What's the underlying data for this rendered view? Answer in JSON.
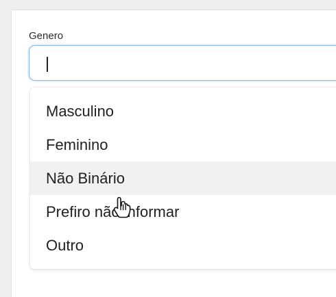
{
  "form": {
    "gender_label": "Genero",
    "gender_value": ""
  },
  "dropdown": {
    "options": [
      "Masculino",
      "Feminino",
      "Não Binário",
      "Prefiro não informar",
      "Outro"
    ],
    "hovered_option": "Não Binário"
  },
  "icons": {
    "cursor": "hand-pointer-cursor-icon"
  },
  "colors": {
    "focus_border": "#8fb3e6",
    "hover_bg": "#f1f1f1"
  }
}
